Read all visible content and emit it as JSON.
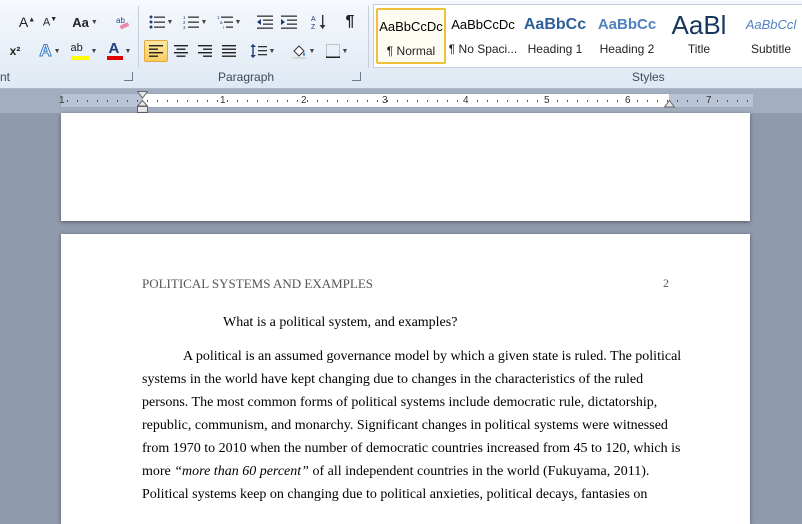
{
  "ribbon": {
    "font_group_label": "nt",
    "paragraph_group_label": "Paragraph",
    "styles_group_label": "Styles",
    "buttons": {
      "grow_font": "A",
      "shrink_font": "A",
      "change_case": "Aa",
      "superscript": "x²",
      "text_effects": "A",
      "highlight": "ab",
      "font_color": "A",
      "show_formatting": "¶"
    },
    "colors": {
      "highlight": "#ffff00",
      "font_color": "#e00000",
      "accent": "#f0c03c"
    },
    "styles": [
      {
        "preview": "AaBbCcDc",
        "name": "¶ Normal",
        "selected": true
      },
      {
        "preview": "AaBbCcDc",
        "name": "¶ No Spaci...",
        "selected": false
      },
      {
        "preview": "AaBbCc",
        "name": "Heading 1",
        "selected": false
      },
      {
        "preview": "AaBbCc",
        "name": "Heading 2",
        "selected": false
      },
      {
        "preview": "AaBl",
        "name": "Title",
        "selected": false
      },
      {
        "preview": "AaBbCcl",
        "name": "Subtitle",
        "selected": false
      }
    ]
  },
  "ruler": {
    "numbers": [
      "1",
      "1",
      "2",
      "3",
      "4",
      "5",
      "6",
      "7"
    ]
  },
  "document": {
    "header_title": "POLITICAL SYSTEMS AND EXAMPLES",
    "page_number": "2",
    "heading": "What is a political system, and examples?",
    "lines": [
      "A political is an assumed governance model by which a given state is ruled. The political",
      "systems in the world have kept changing due to changes in the characteristics of the ruled",
      "persons. The most common forms of political systems include democratic rule, dictatorship,",
      "republic, communism, and monarchy. Significant changes in political systems were witnessed",
      "from 1970 to 2010 when the number of democratic countries increased from 45 to 120, which is"
    ],
    "line6_before": "more ",
    "line6_quote": "“more than 60 percent”",
    "line6_after": " of all independent countries in the world (Fukuyama, 2011).",
    "line7": "Political systems keep on changing due to political anxieties, political decays, fantasies on"
  }
}
